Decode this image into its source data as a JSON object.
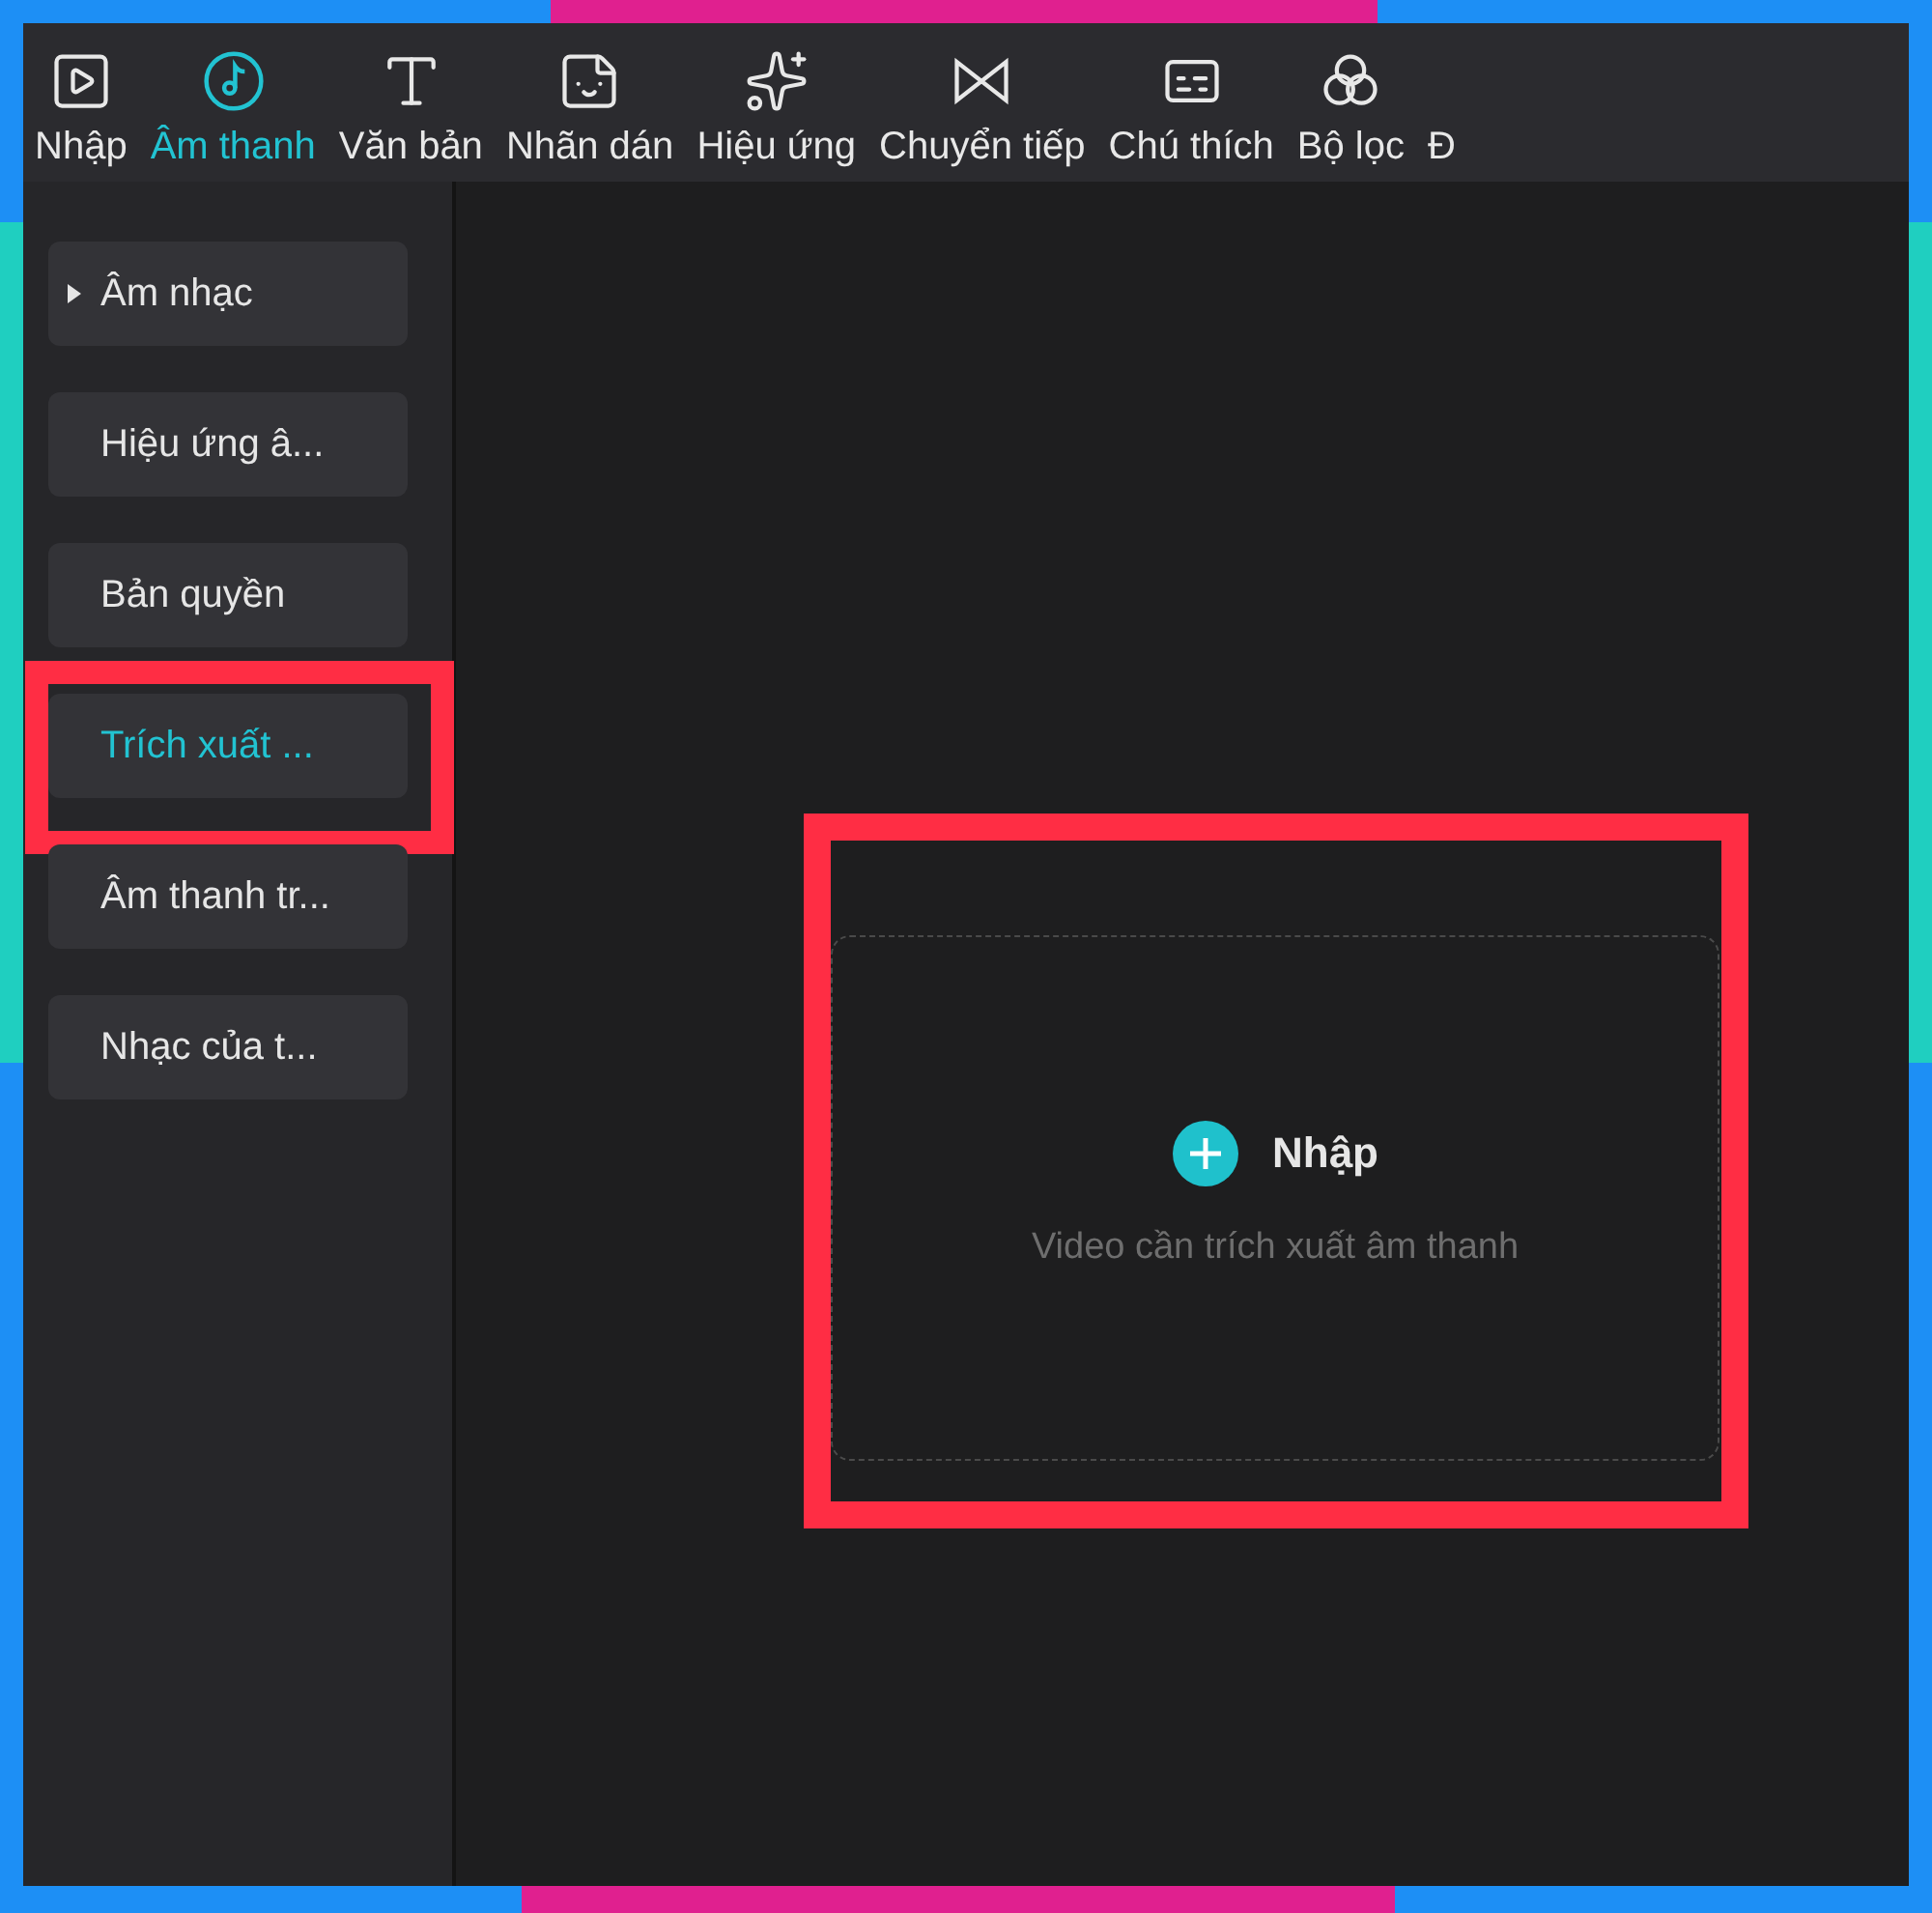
{
  "tabs": [
    {
      "label": "Nhập",
      "kind": "media",
      "selected": false
    },
    {
      "label": "Âm thanh",
      "kind": "audio",
      "selected": true
    },
    {
      "label": "Văn bản",
      "kind": "text",
      "selected": false
    },
    {
      "label": "Nhãn dán",
      "kind": "sticker",
      "selected": false
    },
    {
      "label": "Hiệu ứng",
      "kind": "effect",
      "selected": false
    },
    {
      "label": "Chuyển tiếp",
      "kind": "transition",
      "selected": false
    },
    {
      "label": "Chú thích",
      "kind": "caption",
      "selected": false
    },
    {
      "label": "Bộ lọc",
      "kind": "filter",
      "selected": false
    },
    {
      "label": "Đ",
      "kind": "none",
      "selected": false
    }
  ],
  "sidebar": {
    "items": [
      {
        "label": "Âm nhạc",
        "expandable": true,
        "selected": false
      },
      {
        "label": "Hiệu ứng â...",
        "expandable": false,
        "selected": false
      },
      {
        "label": "Bản quyền",
        "expandable": false,
        "selected": false
      },
      {
        "label": "Trích xuất ...",
        "expandable": false,
        "selected": true
      },
      {
        "label": "Âm thanh tr...",
        "expandable": false,
        "selected": false
      },
      {
        "label": "Nhạc của t...",
        "expandable": false,
        "selected": false
      }
    ]
  },
  "dropzone": {
    "button": "Nhập",
    "hint": "Video cần trích xuất âm thanh"
  }
}
